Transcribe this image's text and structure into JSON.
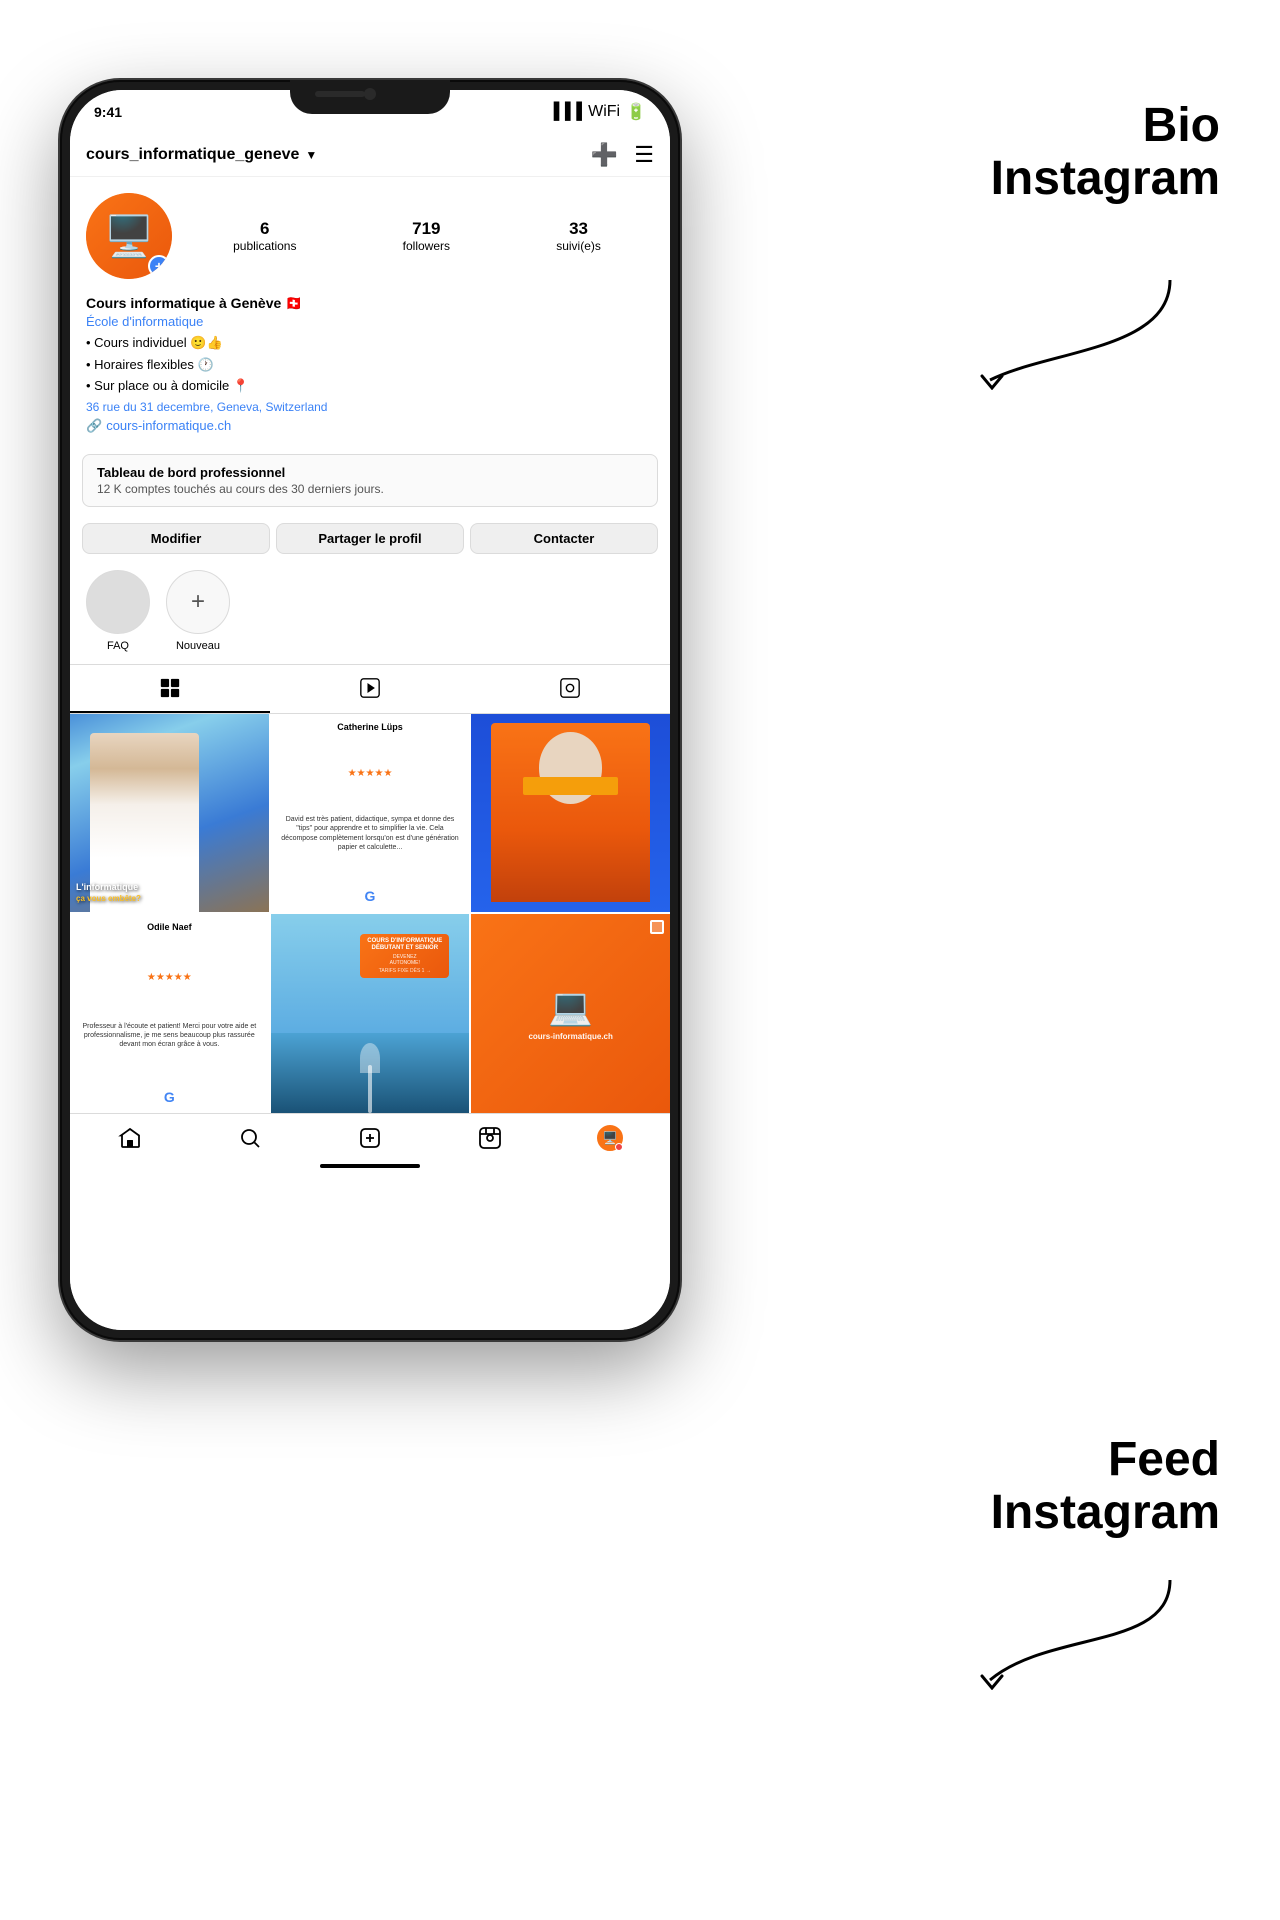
{
  "phone": {
    "status": {
      "time": "9:41"
    }
  },
  "profile": {
    "username": "cours_informatique_geneve",
    "stats": {
      "publications": {
        "count": "6",
        "label": "publications"
      },
      "followers": {
        "count": "719",
        "label": "followers"
      },
      "following": {
        "count": "33",
        "label": "suivi(e)s"
      }
    },
    "bio": {
      "name": "Cours informatique à Genève 🇨🇭",
      "category": "École d'informatique",
      "line1": "• Cours individuel 🙂👍",
      "line2": "• Horaires flexibles 🕐",
      "line3": "• Sur place ou à domicile 📍",
      "address": "36 rue du 31 decembre, Geneva, Switzerland",
      "website": "cours-informatique.ch",
      "link_icon": "🔗"
    },
    "dashboard": {
      "title": "Tableau de bord professionnel",
      "subtitle": "12 K comptes touchés au cours des 30 derniers jours."
    },
    "buttons": {
      "modifier": "Modifier",
      "partager": "Partager le profil",
      "contacter": "Contacter"
    },
    "highlights": [
      {
        "label": "FAQ",
        "icon": "circle"
      },
      {
        "label": "Nouveau",
        "icon": "plus"
      }
    ]
  },
  "tabs": {
    "grid_icon": "⊞",
    "reels_icon": "▷",
    "tagged_icon": "◻"
  },
  "feed": {
    "cell1": {
      "text1": "L'informatique",
      "text2": "ça vous embête?"
    },
    "cell2": {
      "reviewer": "Catherine Lüps",
      "stars": "★★★★★",
      "text": "David est très patient, didactique, sympa et donne des \"tips\" pour apprendre et to simplifier la vie. Cela décompose complètement lorsqu'on est d'une génération papier et calculette..."
    },
    "cell4": {
      "reviewer": "Odile Naef",
      "stars": "★★★★★",
      "text": "Professeur à l'écoute et patient! Merci pour votre aide et professionnalisme, je me sens beaucoup plus rassurée devant mon écran grâce à vous."
    },
    "cell6": {
      "url": "cours-informatique.ch"
    }
  },
  "annotations": {
    "bio": {
      "line1": "Bio",
      "line2": "Instagram"
    },
    "feed": {
      "line1": "Feed",
      "line2": "Instagram"
    }
  },
  "nav": {
    "home": "home",
    "search": "search",
    "add": "add",
    "reels": "reels",
    "profile": "profile"
  }
}
